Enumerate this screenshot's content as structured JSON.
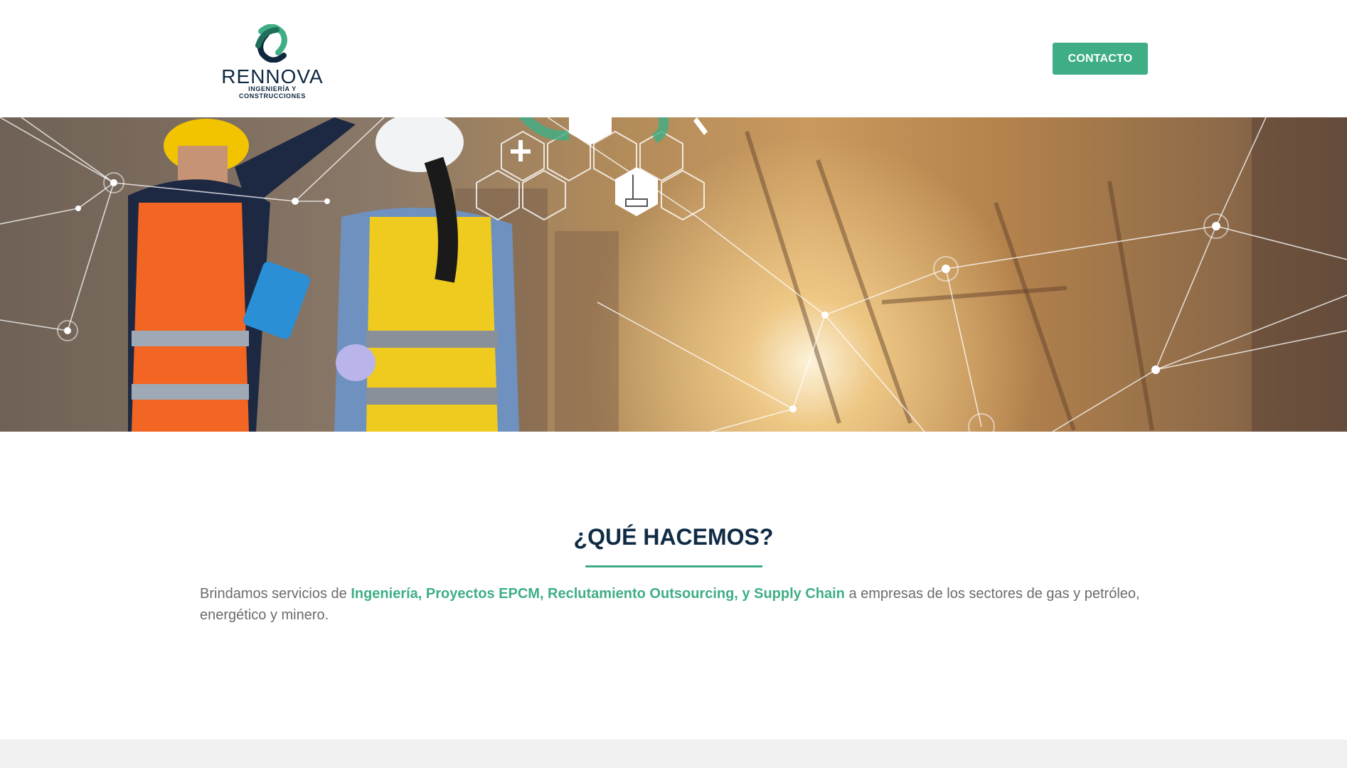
{
  "brand": {
    "name": "RENNOVA",
    "tagline": "INGENIERÍA Y CONSTRUCCIONES",
    "logo_icon": "rennova-logo-icon",
    "primary_color": "#3fae85",
    "dark_color": "#0f2840"
  },
  "header": {
    "contact_label": "CONTACTO"
  },
  "hero": {
    "image": "construction-engineers-network-banner"
  },
  "section": {
    "title": "¿QUÉ HACEMOS?",
    "text_before": "Brindamos servicios de ",
    "highlight": "Ingeniería, Proyectos EPCM, Reclutamiento Outsourcing, y Supply Chain",
    "text_after": " a empresas de los sectores de gas y petróleo, energético y minero."
  }
}
